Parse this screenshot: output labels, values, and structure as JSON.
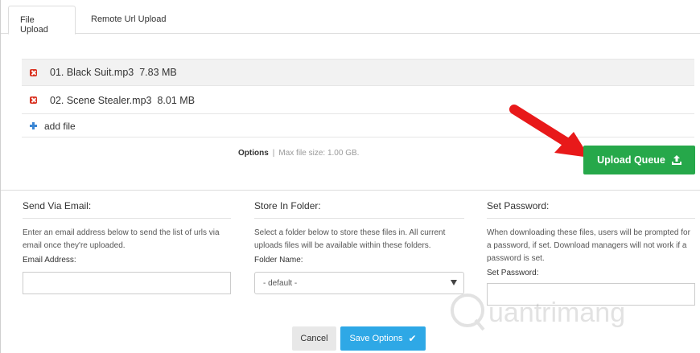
{
  "tabs": [
    {
      "label": "File Upload",
      "active": true
    },
    {
      "label": "Remote Url Upload",
      "active": false
    }
  ],
  "files": [
    {
      "name": "01. Black Suit.mp3",
      "size": "7.83 MB"
    },
    {
      "name": "02. Scene Stealer.mp3",
      "size": "8.01 MB"
    }
  ],
  "add_file_label": "add file",
  "options": {
    "link": "Options",
    "separator": "|",
    "max_size": "Max file size: 1.00 GB."
  },
  "upload_button": {
    "label": "Upload Queue",
    "icon": "upload-icon",
    "color": "#26a84a"
  },
  "arrow_color": "#e8191a",
  "email_section": {
    "title": "Send Via Email:",
    "description": "Enter an email address below to send the list of urls via email once they're uploaded.",
    "field_label": "Email Address:",
    "value": ""
  },
  "folder_section": {
    "title": "Store In Folder:",
    "description": "Select a folder below to store these files in. All current uploads files will be available within these folders.",
    "field_label": "Folder Name:",
    "selected": "- default -"
  },
  "password_section": {
    "title": "Set Password:",
    "description": "When downloading these files, users will be prompted for a password, if set. Download managers will not work if a password is set.",
    "field_label": "Set Password:",
    "value": ""
  },
  "buttons": {
    "cancel": "Cancel",
    "save": "Save Options",
    "save_icon": "check-icon",
    "save_color": "#2ea8e6"
  },
  "watermark_text": "uantrimang"
}
